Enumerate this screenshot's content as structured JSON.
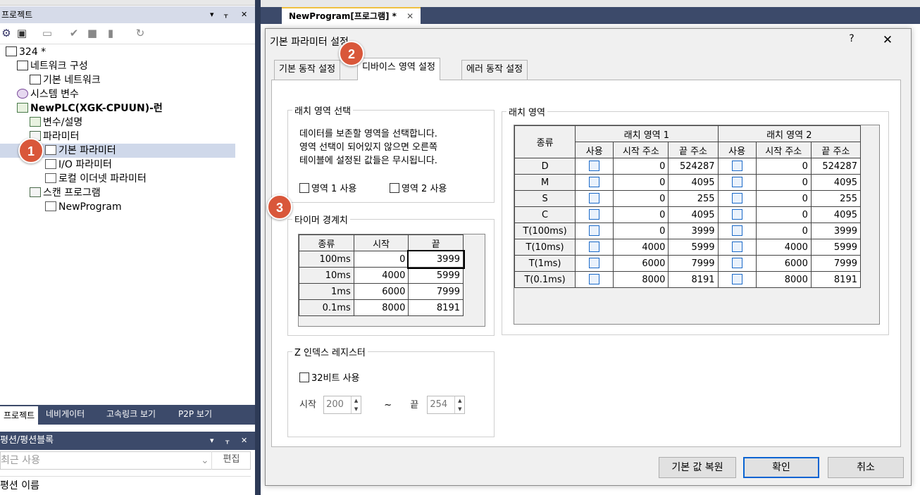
{
  "project_panel": {
    "title": "프로젝트",
    "pin": "▾ ᚁ ✕",
    "tree": [
      {
        "label": "324 *",
        "indent": 0,
        "icon": "network-root-icon"
      },
      {
        "label": "네트워크 구성",
        "indent": 1,
        "icon": "network-icon"
      },
      {
        "label": "기본 네트워크",
        "indent": 2,
        "icon": "basic-network-icon"
      },
      {
        "label": "시스템 변수",
        "indent": 1,
        "icon": "system-variable-icon"
      },
      {
        "label": "NewPLC(XGK-CPUUN)-런",
        "indent": 1,
        "icon": "plc-icon",
        "bold": true
      },
      {
        "label": "변수/설명",
        "indent": 2,
        "icon": "variable-icon"
      },
      {
        "label": "파라미터",
        "indent": 2,
        "icon": "parameter-folder-icon"
      },
      {
        "label": "기본 파라미터",
        "indent": 3,
        "icon": "basic-parameter-icon",
        "selected": true
      },
      {
        "label": "I/O 파라미터",
        "indent": 3,
        "icon": "io-parameter-icon"
      },
      {
        "label": "로컬 이더넷 파라미터",
        "indent": 3,
        "icon": "ethernet-parameter-icon"
      },
      {
        "label": "스캔 프로그램",
        "indent": 2,
        "icon": "scan-program-icon"
      },
      {
        "label": "NewProgram",
        "indent": 3,
        "icon": "program-icon"
      }
    ],
    "tabs": [
      "프로젝트",
      "네비게이터",
      "고속링크 보기",
      "P2P 보기"
    ]
  },
  "function_panel": {
    "title": "평션/평션블록",
    "search_placeholder": "최근 사용",
    "edit_label": "편집",
    "name_header": "평션 이름"
  },
  "editor": {
    "tab_label": "NewProgram[프로그램] *",
    "tab_close": "✕"
  },
  "dialog": {
    "title": "기본 파라미터 설정",
    "help": "?",
    "close": "✕",
    "tabs": [
      "기본 동작 설정",
      "디바이스 영역 설정",
      "에러 동작 설정"
    ],
    "latch_select": {
      "title": "래치 영역 선택",
      "description": [
        "데이터를 보존할 영역을 선택합니다.",
        "영역 선택이 되어있지 않으면 오른쪽",
        "테이블에 설정된 값들은 무시됩니다."
      ],
      "area1_label": "영역 1 사용",
      "area2_label": "영역 2 사용"
    },
    "timer": {
      "title": "타이머 경계치",
      "headers": [
        "종류",
        "시작",
        "끝"
      ],
      "rows": [
        {
          "type": "100ms",
          "start": "0",
          "end": "3999"
        },
        {
          "type": "10ms",
          "start": "4000",
          "end": "5999"
        },
        {
          "type": "1ms",
          "start": "6000",
          "end": "7999"
        },
        {
          "type": "0.1ms",
          "start": "8000",
          "end": "8191"
        }
      ]
    },
    "z_index": {
      "title": "Z 인덱스 레지스터",
      "bit32_label": "32비트 사용",
      "start_label": "시작",
      "start_value": "200",
      "tilde": "~",
      "end_label": "끝",
      "end_value": "254"
    },
    "latch_area": {
      "title": "래치 영역",
      "group1": "래치 영역 1",
      "group2": "래치 영역 2",
      "type_header": "종류",
      "sub_headers": [
        "사용",
        "시작 주소",
        "끝 주소"
      ],
      "rows": [
        {
          "type": "D",
          "s1": "0",
          "e1": "524287",
          "s2": "0",
          "e2": "524287"
        },
        {
          "type": "M",
          "s1": "0",
          "e1": "4095",
          "s2": "0",
          "e2": "4095"
        },
        {
          "type": "S",
          "s1": "0",
          "e1": "255",
          "s2": "0",
          "e2": "255"
        },
        {
          "type": "C",
          "s1": "0",
          "e1": "4095",
          "s2": "0",
          "e2": "4095"
        },
        {
          "type": "T(100ms)",
          "s1": "0",
          "e1": "3999",
          "s2": "0",
          "e2": "3999"
        },
        {
          "type": "T(10ms)",
          "s1": "4000",
          "e1": "5999",
          "s2": "4000",
          "e2": "5999"
        },
        {
          "type": "T(1ms)",
          "s1": "6000",
          "e1": "7999",
          "s2": "6000",
          "e2": "7999"
        },
        {
          "type": "T(0.1ms)",
          "s1": "8000",
          "e1": "8191",
          "s2": "8000",
          "e2": "8191"
        }
      ]
    },
    "buttons": {
      "restore": "기본 값 복원",
      "ok": "확인",
      "cancel": "취소"
    }
  },
  "badges": [
    "1",
    "2",
    "3"
  ],
  "colors": {
    "badge": "#d9573a",
    "panel_dark": "#3c4a6a",
    "checkbox_blue": "#1b6ac9"
  }
}
